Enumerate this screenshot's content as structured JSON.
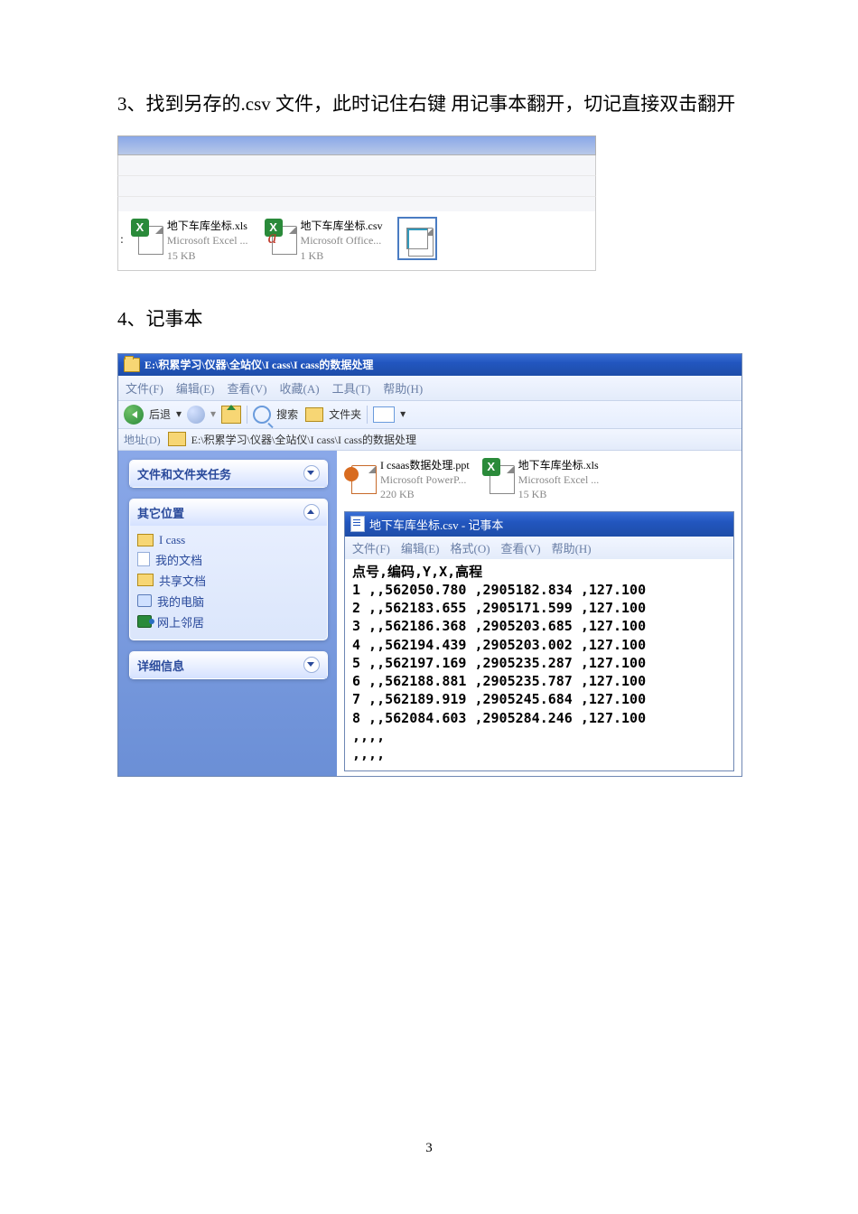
{
  "para1": "3、找到另存的.csv 文件，此时记住右键 用记事本翻开，切记直接双击翻开",
  "para2": "4、记事本",
  "page_number": "3",
  "files1": {
    "xls": {
      "name": "地下车库坐标.xls",
      "meta1": "Microsoft Excel ...",
      "meta2": "15 KB"
    },
    "csv": {
      "name": "地下车库坐标.csv",
      "meta1": "Microsoft Office...",
      "meta2": "1 KB"
    }
  },
  "explorer": {
    "title": "E:\\积累学习\\仪器\\全站仪\\I  cass\\I  cass的数据处理",
    "menu": {
      "file": "文件(F)",
      "edit": "编辑(E)",
      "view": "查看(V)",
      "fav": "收藏(A)",
      "tool": "工具(T)",
      "help": "帮助(H)"
    },
    "toolbar": {
      "back": "后退",
      "search": "搜索",
      "folders": "文件夹"
    },
    "addr_label": "地址(D)",
    "addr_path": "E:\\积累学习\\仪器\\全站仪\\I  cass\\I  cass的数据处理",
    "task1": "文件和文件夹任务",
    "task2": "其它位置",
    "task3": "详细信息",
    "nav": {
      "cass": "I  cass",
      "mydoc": "我的文档",
      "shared": "共享文档",
      "mypc": "我的电脑",
      "net": "网上邻居"
    },
    "rfiles": {
      "ppt": {
        "name": "I csaas数据处理.ppt",
        "meta1": "Microsoft PowerP...",
        "meta2": "220 KB"
      },
      "xls": {
        "name": "地下车库坐标.xls",
        "meta1": "Microsoft Excel ...",
        "meta2": "15 KB"
      }
    }
  },
  "notepad": {
    "title": "地下车库坐标.csv - 记事本",
    "menu": {
      "file": "文件(F)",
      "edit": "编辑(E)",
      "fmt": "格式(O)",
      "view": "查看(V)",
      "help": "帮助(H)"
    },
    "header": "点号,编码,Y,X,高程",
    "lines": [
      "1 ,,562050.780 ,2905182.834 ,127.100",
      "2 ,,562183.655 ,2905171.599 ,127.100",
      "3 ,,562186.368 ,2905203.685 ,127.100",
      "4 ,,562194.439 ,2905203.002 ,127.100",
      "5 ,,562197.169 ,2905235.287 ,127.100",
      "6 ,,562188.881 ,2905235.787 ,127.100",
      "7 ,,562189.919 ,2905245.684 ,127.100",
      "8 ,,562084.603 ,2905284.246 ,127.100",
      ",,,,",
      ",,,,"
    ]
  }
}
